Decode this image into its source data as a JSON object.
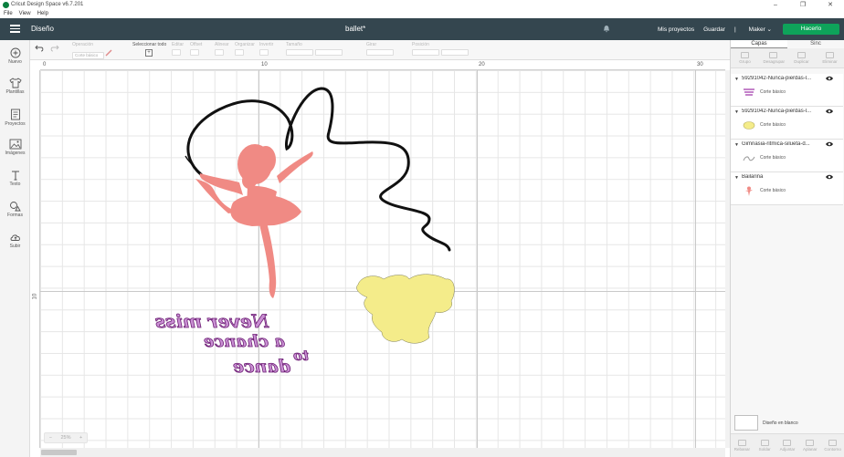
{
  "window": {
    "title": "Cricut Design Space  v6.7.201",
    "controls": [
      "–",
      "❐",
      "✕"
    ]
  },
  "menu": [
    "File",
    "View",
    "Help"
  ],
  "header": {
    "section": "Diseño",
    "document": "ballet*",
    "my_projects": "Mis proyectos",
    "save": "Guardar",
    "separator": "|",
    "machine": "Maker",
    "make_button": "Hacerlo",
    "accent": "#0ea35a",
    "bar_color": "#34464f"
  },
  "toolbar": {
    "operation_label": "Operación",
    "operation_value": "Corte básico",
    "select_all_label": "Seleccionar todo",
    "edit_label": "Editar",
    "offset_label": "Offset",
    "align_label": "Alinear",
    "arrange_label": "Organizar",
    "flip_label": "Invertir",
    "size_label": "Tamaño",
    "rotate_label": "Girar",
    "position_label": "Posición"
  },
  "leftnav": [
    {
      "label": "Nuevo",
      "icon": "plus-circle-icon"
    },
    {
      "label": "Plantillas",
      "icon": "tshirt-icon"
    },
    {
      "label": "Proyectos",
      "icon": "projects-icon"
    },
    {
      "label": "Imágenes",
      "icon": "images-icon"
    },
    {
      "label": "Texto",
      "icon": "text-icon"
    },
    {
      "label": "Formas",
      "icon": "shapes-icon"
    },
    {
      "label": "Subir",
      "icon": "upload-cloud-icon"
    }
  ],
  "ruler": {
    "top": [
      "0",
      "10",
      "20",
      "30"
    ],
    "left": [
      "10"
    ]
  },
  "zoom": {
    "minus": "−",
    "value": "25%",
    "plus": "+"
  },
  "panel": {
    "tabs": [
      "Capas",
      "Sinc"
    ],
    "actions": [
      "Grupo",
      "Desagrupar",
      "Duplicar",
      "Eliminar"
    ],
    "layers": [
      {
        "name": "59291042-Nunca-pierdas-l...",
        "operation": "Corte básico",
        "color": "#b05ab8"
      },
      {
        "name": "59291042-Nunca-pierdas-l...",
        "operation": "Corte básico",
        "color": "#f4ec8a"
      },
      {
        "name": "Gimnasia-ritmica-silueta-d...",
        "operation": "Corte básico",
        "color": "#888888"
      },
      {
        "name": "Bailarina",
        "operation": "Corte básico",
        "color": "#f08a84"
      }
    ],
    "blank_canvas": "Diseño en blanco",
    "bottom_actions": [
      "Rebanar",
      "Soldar",
      "Adjuntar",
      "Aplanar",
      "Contorno"
    ]
  },
  "canvas_text": {
    "line1": "Never miss",
    "line2": "a chance",
    "line3": "to",
    "line4": "dance"
  }
}
